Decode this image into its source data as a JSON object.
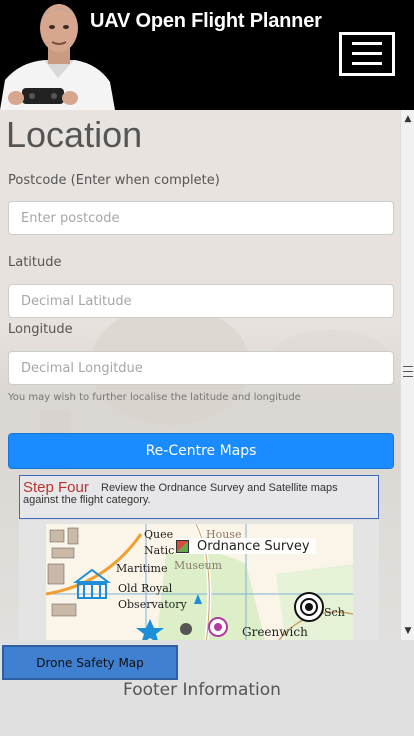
{
  "header": {
    "title": "UAV Open Flight Planner"
  },
  "location": {
    "heading": "Location",
    "postcode_label": "Postcode (Enter when complete)",
    "postcode_placeholder": "Enter postcode",
    "latitude_label": "Latitude",
    "latitude_placeholder": "Decimal Latitude",
    "longitude_label": "Longitude",
    "longitude_placeholder": "Decimal Longitdue",
    "hint": "You may wish to further localise the latitude and longitude",
    "recentre_label": "Re-Centre Maps"
  },
  "step_four": {
    "title": "Step Four",
    "text": "Review the Ordnance Survey and Satellite maps against the flight category."
  },
  "map": {
    "layer_title": "Ordnance Survey",
    "place_labels": [
      "Quee",
      "Natic",
      "Maritime",
      "Old Royal",
      "Observatory",
      "Greenwich",
      "Sch",
      "House",
      "Museum"
    ]
  },
  "footer": {
    "drone_safety_label": "Drone Safety Map",
    "text": "Footer Information"
  },
  "colors": {
    "header_bg": "#000000",
    "primary": "#1a8cff",
    "step_title": "#b5362e",
    "safety_button": "#3f80d1"
  }
}
